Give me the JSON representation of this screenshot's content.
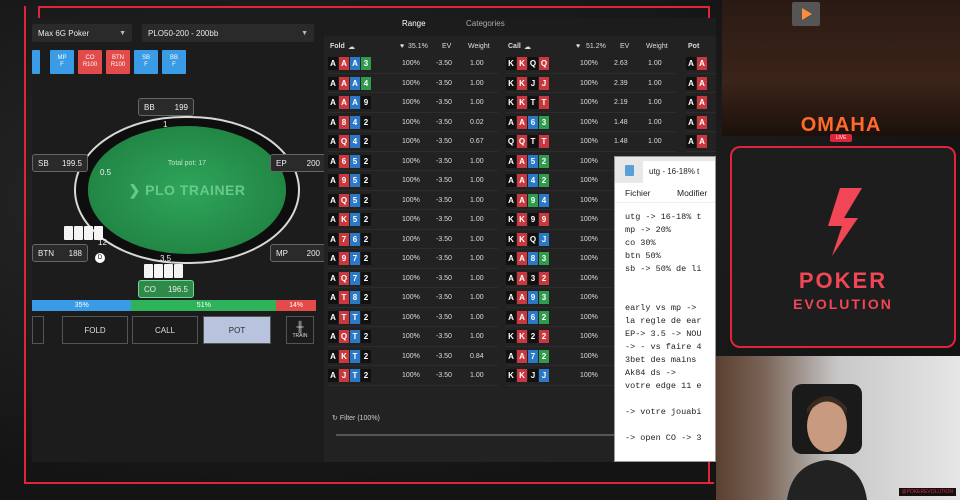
{
  "left": {
    "game_select": "Max 6G Poker",
    "scenario_select": "PLO50-200 - 200bb",
    "position_buttons": [
      {
        "label": "MP\nF",
        "color": "blue"
      },
      {
        "label": "CO\nR100",
        "color": "red"
      },
      {
        "label": "BTN\nR100",
        "color": "red"
      },
      {
        "label": "SB\nF",
        "color": "blue"
      },
      {
        "label": "BB\nF",
        "color": "blue"
      }
    ],
    "table": {
      "brand": "PLO TRAINER",
      "pot": "Total pot: 17",
      "seats": {
        "bb": {
          "name": "BB",
          "stack": "199",
          "bet": "1"
        },
        "sb": {
          "name": "SB",
          "stack": "199.5",
          "bet": "0.5"
        },
        "ep": {
          "name": "EP",
          "stack": "200"
        },
        "btn": {
          "name": "BTN",
          "stack": "188",
          "bet": "12"
        },
        "mp": {
          "name": "MP",
          "stack": "200"
        },
        "co": {
          "name": "CO",
          "stack": "196.5",
          "bet": "3.5"
        }
      },
      "dealer": "D"
    },
    "frequencies": [
      {
        "label": "35%",
        "value": 35,
        "color": "#3a9be6"
      },
      {
        "label": "51%",
        "value": 51,
        "color": "#2fb35a"
      },
      {
        "label": "14%",
        "value": 14,
        "color": "#e34b4b"
      }
    ],
    "actions": {
      "fold": "FOLD",
      "call": "CALL",
      "pot": "POT",
      "train": "TRAIN"
    }
  },
  "right": {
    "tabs": {
      "range": "Range",
      "categories": "Categories"
    },
    "fold_col": {
      "label": "Fold",
      "pct": "35.1%",
      "ev": "EV",
      "weight": "Weight",
      "rows": [
        {
          "cards": [
            [
              "A",
              "s"
            ],
            [
              "A",
              "h"
            ],
            [
              "A",
              "d"
            ],
            [
              "3",
              "c"
            ]
          ],
          "pct": "100%",
          "ev": "-3.50",
          "w": "1.00"
        },
        {
          "cards": [
            [
              "A",
              "s"
            ],
            [
              "A",
              "h"
            ],
            [
              "A",
              "d"
            ],
            [
              "4",
              "c"
            ]
          ],
          "pct": "100%",
          "ev": "-3.50",
          "w": "1.00"
        },
        {
          "cards": [
            [
              "A",
              "s"
            ],
            [
              "A",
              "h"
            ],
            [
              "A",
              "d"
            ],
            [
              "9",
              "s"
            ]
          ],
          "pct": "100%",
          "ev": "-3.50",
          "w": "1.00"
        },
        {
          "cards": [
            [
              "A",
              "s"
            ],
            [
              "8",
              "h"
            ],
            [
              "4",
              "d"
            ],
            [
              "2",
              "s"
            ]
          ],
          "pct": "100%",
          "ev": "-3.50",
          "w": "0.02"
        },
        {
          "cards": [
            [
              "A",
              "s"
            ],
            [
              "Q",
              "h"
            ],
            [
              "4",
              "d"
            ],
            [
              "2",
              "s"
            ]
          ],
          "pct": "100%",
          "ev": "-3.50",
          "w": "0.67"
        },
        {
          "cards": [
            [
              "A",
              "s"
            ],
            [
              "6",
              "h"
            ],
            [
              "5",
              "d"
            ],
            [
              "2",
              "s"
            ]
          ],
          "pct": "100%",
          "ev": "-3.50",
          "w": "1.00"
        },
        {
          "cards": [
            [
              "A",
              "s"
            ],
            [
              "9",
              "h"
            ],
            [
              "5",
              "d"
            ],
            [
              "2",
              "s"
            ]
          ],
          "pct": "100%",
          "ev": "-3.50",
          "w": "1.00"
        },
        {
          "cards": [
            [
              "A",
              "s"
            ],
            [
              "Q",
              "h"
            ],
            [
              "5",
              "d"
            ],
            [
              "2",
              "s"
            ]
          ],
          "pct": "100%",
          "ev": "-3.50",
          "w": "1.00"
        },
        {
          "cards": [
            [
              "A",
              "s"
            ],
            [
              "K",
              "h"
            ],
            [
              "5",
              "d"
            ],
            [
              "2",
              "s"
            ]
          ],
          "pct": "100%",
          "ev": "-3.50",
          "w": "1.00"
        },
        {
          "cards": [
            [
              "A",
              "s"
            ],
            [
              "7",
              "h"
            ],
            [
              "6",
              "d"
            ],
            [
              "2",
              "s"
            ]
          ],
          "pct": "100%",
          "ev": "-3.50",
          "w": "1.00"
        },
        {
          "cards": [
            [
              "A",
              "s"
            ],
            [
              "9",
              "h"
            ],
            [
              "7",
              "d"
            ],
            [
              "2",
              "s"
            ]
          ],
          "pct": "100%",
          "ev": "-3.50",
          "w": "1.00"
        },
        {
          "cards": [
            [
              "A",
              "s"
            ],
            [
              "Q",
              "h"
            ],
            [
              "7",
              "d"
            ],
            [
              "2",
              "s"
            ]
          ],
          "pct": "100%",
          "ev": "-3.50",
          "w": "1.00"
        },
        {
          "cards": [
            [
              "A",
              "s"
            ],
            [
              "T",
              "h"
            ],
            [
              "8",
              "d"
            ],
            [
              "2",
              "s"
            ]
          ],
          "pct": "100%",
          "ev": "-3.50",
          "w": "1.00"
        },
        {
          "cards": [
            [
              "A",
              "s"
            ],
            [
              "T",
              "h"
            ],
            [
              "T",
              "d"
            ],
            [
              "2",
              "s"
            ]
          ],
          "pct": "100%",
          "ev": "-3.50",
          "w": "1.00"
        },
        {
          "cards": [
            [
              "A",
              "s"
            ],
            [
              "Q",
              "h"
            ],
            [
              "T",
              "d"
            ],
            [
              "2",
              "s"
            ]
          ],
          "pct": "100%",
          "ev": "-3.50",
          "w": "1.00"
        },
        {
          "cards": [
            [
              "A",
              "s"
            ],
            [
              "K",
              "h"
            ],
            [
              "T",
              "d"
            ],
            [
              "2",
              "s"
            ]
          ],
          "pct": "100%",
          "ev": "-3.50",
          "w": "0.84"
        },
        {
          "cards": [
            [
              "A",
              "s"
            ],
            [
              "J",
              "h"
            ],
            [
              "T",
              "d"
            ],
            [
              "2",
              "s"
            ]
          ],
          "pct": "100%",
          "ev": "-3.50",
          "w": "1.00"
        }
      ]
    },
    "call_col": {
      "label": "Call",
      "pct": "51.2%",
      "ev": "EV",
      "weight": "Weight",
      "rows": [
        {
          "cards": [
            [
              "K",
              "s"
            ],
            [
              "K",
              "h"
            ],
            [
              "Q",
              "s"
            ],
            [
              "Q",
              "h"
            ]
          ],
          "pct": "100%",
          "ev": "2.63",
          "w": "1.00"
        },
        {
          "cards": [
            [
              "K",
              "s"
            ],
            [
              "K",
              "h"
            ],
            [
              "J",
              "s"
            ],
            [
              "J",
              "h"
            ]
          ],
          "pct": "100%",
          "ev": "2.39",
          "w": "1.00"
        },
        {
          "cards": [
            [
              "K",
              "s"
            ],
            [
              "K",
              "h"
            ],
            [
              "T",
              "s"
            ],
            [
              "T",
              "h"
            ]
          ],
          "pct": "100%",
          "ev": "2.19",
          "w": "1.00"
        },
        {
          "cards": [
            [
              "A",
              "s"
            ],
            [
              "A",
              "h"
            ],
            [
              "6",
              "d"
            ],
            [
              "3",
              "c"
            ]
          ],
          "pct": "100%",
          "ev": "1.48",
          "w": "1.00"
        },
        {
          "cards": [
            [
              "Q",
              "s"
            ],
            [
              "Q",
              "h"
            ],
            [
              "T",
              "s"
            ],
            [
              "T",
              "h"
            ]
          ],
          "pct": "100%",
          "ev": "1.48",
          "w": "1.00"
        },
        {
          "cards": [
            [
              "A",
              "s"
            ],
            [
              "A",
              "h"
            ],
            [
              "5",
              "d"
            ],
            [
              "2",
              "c"
            ]
          ],
          "pct": "100%",
          "ev": "",
          "w": ""
        },
        {
          "cards": [
            [
              "A",
              "s"
            ],
            [
              "A",
              "h"
            ],
            [
              "4",
              "d"
            ],
            [
              "2",
              "c"
            ]
          ],
          "pct": "100%",
          "ev": "",
          "w": ""
        },
        {
          "cards": [
            [
              "A",
              "s"
            ],
            [
              "A",
              "h"
            ],
            [
              "9",
              "c"
            ],
            [
              "4",
              "d"
            ]
          ],
          "pct": "100%",
          "ev": "",
          "w": ""
        },
        {
          "cards": [
            [
              "K",
              "s"
            ],
            [
              "K",
              "h"
            ],
            [
              "9",
              "s"
            ],
            [
              "9",
              "h"
            ]
          ],
          "pct": "100%",
          "ev": "",
          "w": ""
        },
        {
          "cards": [
            [
              "K",
              "s"
            ],
            [
              "K",
              "h"
            ],
            [
              "Q",
              "s"
            ],
            [
              "J",
              "d"
            ]
          ],
          "pct": "100%",
          "ev": "",
          "w": ""
        },
        {
          "cards": [
            [
              "A",
              "s"
            ],
            [
              "A",
              "h"
            ],
            [
              "8",
              "d"
            ],
            [
              "3",
              "c"
            ]
          ],
          "pct": "100%",
          "ev": "",
          "w": ""
        },
        {
          "cards": [
            [
              "A",
              "s"
            ],
            [
              "A",
              "h"
            ],
            [
              "3",
              "s"
            ],
            [
              "2",
              "h"
            ]
          ],
          "pct": "100%",
          "ev": "",
          "w": ""
        },
        {
          "cards": [
            [
              "A",
              "s"
            ],
            [
              "A",
              "h"
            ],
            [
              "9",
              "d"
            ],
            [
              "3",
              "c"
            ]
          ],
          "pct": "100%",
          "ev": "",
          "w": ""
        },
        {
          "cards": [
            [
              "A",
              "s"
            ],
            [
              "A",
              "h"
            ],
            [
              "6",
              "d"
            ],
            [
              "2",
              "c"
            ]
          ],
          "pct": "100%",
          "ev": "",
          "w": ""
        },
        {
          "cards": [
            [
              "K",
              "s"
            ],
            [
              "K",
              "h"
            ],
            [
              "2",
              "s"
            ],
            [
              "2",
              "h"
            ]
          ],
          "pct": "100%",
          "ev": "",
          "w": ""
        },
        {
          "cards": [
            [
              "A",
              "s"
            ],
            [
              "A",
              "h"
            ],
            [
              "7",
              "d"
            ],
            [
              "2",
              "c"
            ]
          ],
          "pct": "100%",
          "ev": "",
          "w": ""
        },
        {
          "cards": [
            [
              "K",
              "s"
            ],
            [
              "K",
              "h"
            ],
            [
              "J",
              "s"
            ],
            [
              "J",
              "d"
            ]
          ],
          "pct": "100%",
          "ev": "",
          "w": ""
        }
      ]
    },
    "pot_col": {
      "label": "Pot",
      "rows": [
        [
          [
            "A",
            "s"
          ],
          [
            "A",
            "h"
          ]
        ],
        [
          [
            "A",
            "s"
          ],
          [
            "A",
            "h"
          ]
        ],
        [
          [
            "A",
            "s"
          ],
          [
            "A",
            "h"
          ]
        ],
        [
          [
            "A",
            "s"
          ],
          [
            "A",
            "h"
          ]
        ],
        [
          [
            "A",
            "s"
          ],
          [
            "A",
            "h"
          ]
        ]
      ]
    },
    "filter": "Filter (100%)"
  },
  "notepad": {
    "tab_title": "utg - 16-18% t",
    "menu": {
      "file": "Fichier",
      "edit": "Modifier"
    },
    "text": "utg -> 16-18% t\nmp -> 20%\nco 30%\nbtn 50%\nsb -> 50% de li\n\n\nearly vs mp ->\nla regle de ear\nEP-> 3.5 -> NOU\n-> - vs faire 4\n3bet des mains\nAk84 ds ->\nvotre edge 11 e\n\n-> votre jouabi\n\n-> open CO -> 3"
  },
  "promo": {
    "title": "OMAHA",
    "live": "LIVE"
  },
  "brand_panel": {
    "line1": "POKER",
    "line2": "EVOLUTION"
  },
  "webcam": {
    "tag": "@POKEREVOLUTION"
  }
}
